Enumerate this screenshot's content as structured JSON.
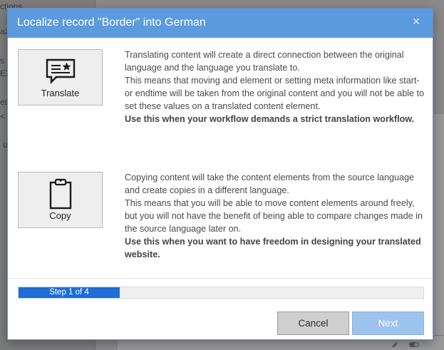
{
  "background": {
    "fragments": [
      "ctions",
      "azin",
      "s a",
      "EX",
      "es",
      "<",
      "u"
    ]
  },
  "dialog": {
    "title": "Localize record \"Border\" into German",
    "close_symbol": "×"
  },
  "options": [
    {
      "label": "Translate",
      "icon": "chat-star-icon",
      "paragraphs": [
        "Translating content will create a direct connection between the original language and the language you translate to.",
        "This means that moving and element or setting meta information like start- or endtime will be taken from the original content and you will not be able to set these values on a translated content element."
      ],
      "emphasis": "Use this when your workflow demands a strict translation workflow."
    },
    {
      "label": "Copy",
      "icon": "clipboard-icon",
      "paragraphs": [
        "Copying content will take the content elements from the source language and create copies in a different language.",
        "This means that you will be able to move content elements around freely, but you will not have the benefit of being able to compare changes made in the source language later on."
      ],
      "emphasis": "Use this when you want to have freedom in designing your translated website."
    }
  ],
  "progress": {
    "text": "Step 1 of 4",
    "fraction": 0.25,
    "color": "#1f6ed8"
  },
  "buttons": {
    "cancel": "Cancel",
    "next": "Next"
  },
  "colors": {
    "header": "#5c9ade",
    "next_disabled": "#9cc3ed"
  }
}
